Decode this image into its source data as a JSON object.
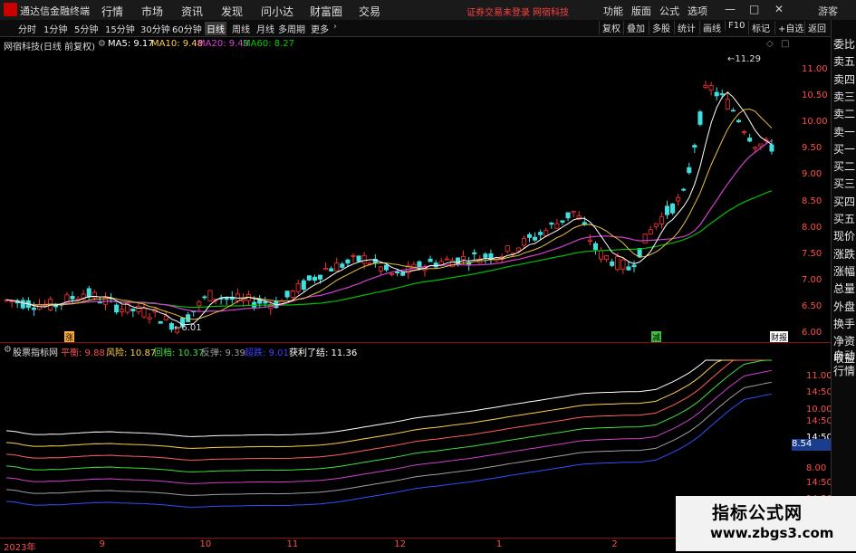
{
  "app": {
    "name": "通达信金融终端",
    "menu": [
      "行情",
      "市场",
      "资讯",
      "发现",
      "问小达",
      "财富圈",
      "交易"
    ],
    "warning": "证券交易未登录",
    "stock_tag": "网宿科技",
    "right_menu": [
      "功能",
      "版面",
      "公式",
      "选项"
    ],
    "guest": "游客",
    "win_min": "—",
    "win_max": "□",
    "win_close": "✕"
  },
  "toolbar": {
    "periods": [
      "分时",
      "1分钟",
      "5分钟",
      "15分钟",
      "30分钟",
      "60分钟",
      "日线",
      "周线",
      "月线",
      "多周期",
      "更多"
    ],
    "active": "日线",
    "right": [
      "复权",
      "叠加",
      "多股",
      "统计",
      "画线",
      "F10",
      "标记",
      "+自选",
      "返回"
    ]
  },
  "infobar": {
    "title": "网宿科技(日线 前复权)",
    "ma": [
      {
        "label": "MA5: 9.17",
        "color": "#ffffff"
      },
      {
        "label": "MA10: 9.48",
        "color": "#ffd24a"
      },
      {
        "label": "MA20: 9.43",
        "color": "#e040e0"
      },
      {
        "label": "MA60: 8.27",
        "color": "#00d000"
      }
    ]
  },
  "right_panel": [
    "委比",
    "卖五",
    "卖四",
    "卖三",
    "卖二",
    "卖一",
    "买一",
    "买二",
    "买三",
    "买四",
    "买五",
    "现价",
    "涨跌",
    "涨幅",
    "总量",
    "外盘",
    "换手",
    "净资",
    "收益",
    "自动",
    "行情"
  ],
  "price_axis": [
    "11.00",
    "10.50",
    "10.00",
    "9.50",
    "9.00",
    "8.50",
    "8.00",
    "7.50",
    "7.00",
    "6.50",
    "6.00"
  ],
  "annotations": {
    "high": "11.29",
    "low": "6.01",
    "tag_left": "涨",
    "tag_mid": "减",
    "tag_right": "财报"
  },
  "indicator": {
    "name": "股票指标网",
    "values": [
      {
        "label": "平衡: 9.88",
        "color": "#ff4d4d"
      },
      {
        "label": "风险: 10.87",
        "color": "#ffd24a"
      },
      {
        "label": "回档: 10.37",
        "color": "#40e040"
      },
      {
        "label": "反弹: 9.39",
        "color": "#a0a0a0"
      },
      {
        "label": "超跌: 9.01",
        "color": "#4040ff"
      },
      {
        "label": "获利了结: 11.36",
        "color": "#ffffff"
      }
    ],
    "axis": [
      "11.00",
      "14:50",
      "10.00",
      "14:50",
      "14:50",
      "8.00",
      "14:50",
      "14:50"
    ],
    "current": "8.54"
  },
  "xaxis": [
    {
      "label": "2023年",
      "pos": 0.0
    },
    {
      "label": "9",
      "pos": 0.121
    },
    {
      "label": "10",
      "pos": 0.248
    },
    {
      "label": "11",
      "pos": 0.358
    },
    {
      "label": "12",
      "pos": 0.494
    },
    {
      "label": "1",
      "pos": 0.623
    },
    {
      "label": "2",
      "pos": 0.769
    }
  ],
  "watermark": {
    "line1": "指标公式网",
    "line2": "www.zbgs3.com"
  }
}
